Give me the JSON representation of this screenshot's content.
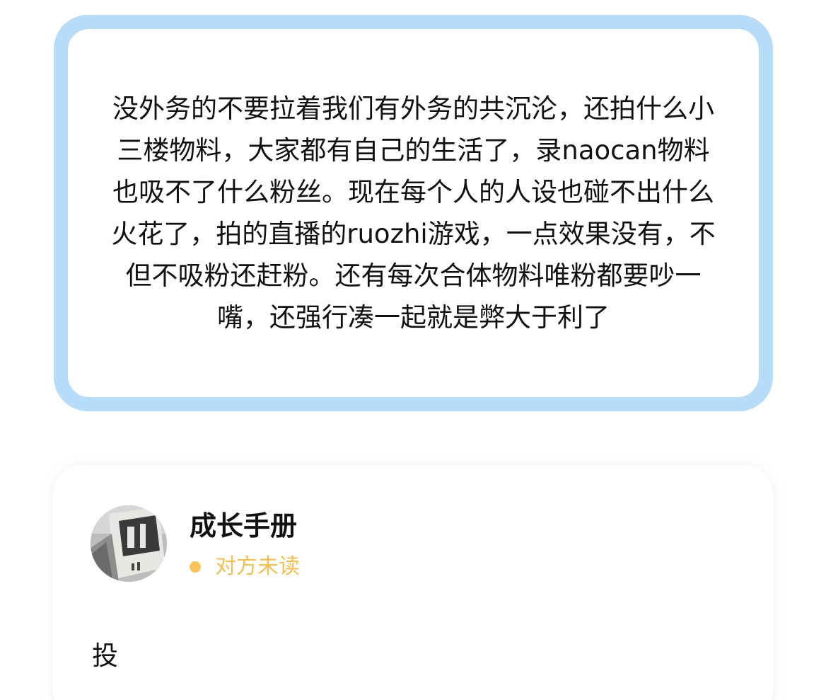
{
  "quote": {
    "text": "没外务的不要拉着我们有外务的共沉沦，还拍什么小三楼物料，大家都有自己的生活了，录naocan物料也吸不了什么粉丝。现在每个人的人设也碰不出什么火花了，拍的直播的ruozhi游戏，一点效果没有，不但不吸粉还赶粉。还有每次合体物料唯粉都要吵一嘴，还强行凑一起就是弊大于利了",
    "border_color": "#b7dcf9"
  },
  "message": {
    "sender_name": "成长手册",
    "read_status": "对方未读",
    "status_color": "#f3bf55",
    "body": "投",
    "avatar_icon": "book-photo-avatar"
  }
}
